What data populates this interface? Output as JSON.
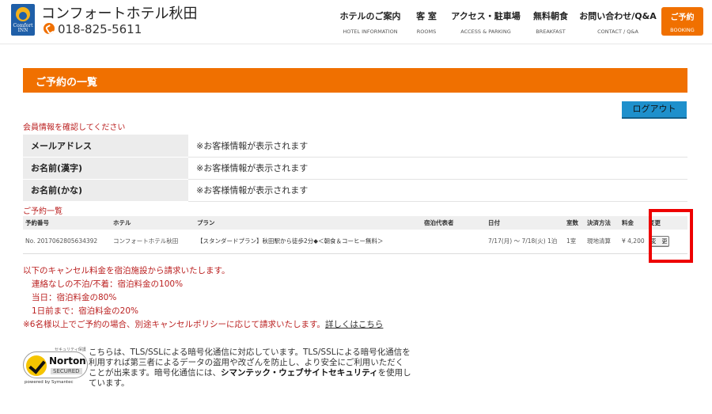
{
  "header": {
    "logo_text": "Comfort INN",
    "hotel_name": "コンフォートホテル秋田",
    "phone_icon": "phone-icon",
    "phone": "018-825-5611",
    "nav": [
      {
        "jp": "ホテルのご案内",
        "en": "HOTEL INFORMATION"
      },
      {
        "jp": "客 室",
        "en": "ROOMS"
      },
      {
        "jp": "アクセス・駐車場",
        "en": "ACCESS & PARKING"
      },
      {
        "jp": "無料朝食",
        "en": "BREAKFAST"
      },
      {
        "jp": "お問い合わせ/Q&A",
        "en": "CONTACT / Q&A"
      }
    ],
    "booking": {
      "jp": "ご予約",
      "en": "BOOKING"
    }
  },
  "title": "ご予約の一覧",
  "logout_label": "ログアウト",
  "notice": "会員情報を確認してください",
  "member_info": [
    {
      "key": "メールアドレス",
      "value": "※お客様情報が表示されます"
    },
    {
      "key": "お名前(漢字)",
      "value": "※お客様情報が表示されます"
    },
    {
      "key": "お名前(かな)",
      "value": "※お客様情報が表示されます"
    }
  ],
  "list_label": "ご予約一覧",
  "reservation_table": {
    "headers": [
      "予約番号",
      "ホテル",
      "プラン",
      "宿泊代表者",
      "日付",
      "室数",
      "決済方法",
      "料金",
      "変更"
    ],
    "row": {
      "number": "No. 2017062805634392",
      "hotel": "コンフォートホテル秋田",
      "plan": "【スタンダードプラン】秋田駅から徒歩2分◆＜朝食＆コーヒー無料＞",
      "representative": "",
      "date": "7/17(月) ～ 7/18(火) 1泊",
      "rooms": "1室",
      "payment": "現地清算",
      "price": "¥ 4,200",
      "change_label": "変　更"
    }
  },
  "cancel_policy": {
    "lead": "以下のキャンセル料金を宿泊施設から請求いたします。",
    "items": [
      "連絡なしの不泊/不着：宿泊料金の100%",
      "当日：宿泊料金の80%",
      "1日前まで：宿泊料金の20%"
    ],
    "note": "※6名様以上でご予約の場合、別途キャンセルポリシーに応じて請求いたします。",
    "more_link": "詳しくはこちら"
  },
  "norton": {
    "top": "セキュリティ保護",
    "name": "Norton",
    "secured": "SECURED",
    "by": "powered by Symantec"
  },
  "ssl": {
    "text1": "こちらは、TLS/SSLによる暗号化通信に対応しています。TLS/SSLによる暗号化通信を利用すれば第三者によるデータの盗用や改ざんを防止し、より安全にご利用いただくことが出来ます。暗号化通信には、",
    "bold": "シマンテック・ウェブサイトセキュリティ",
    "text2": "を使用しています。"
  }
}
